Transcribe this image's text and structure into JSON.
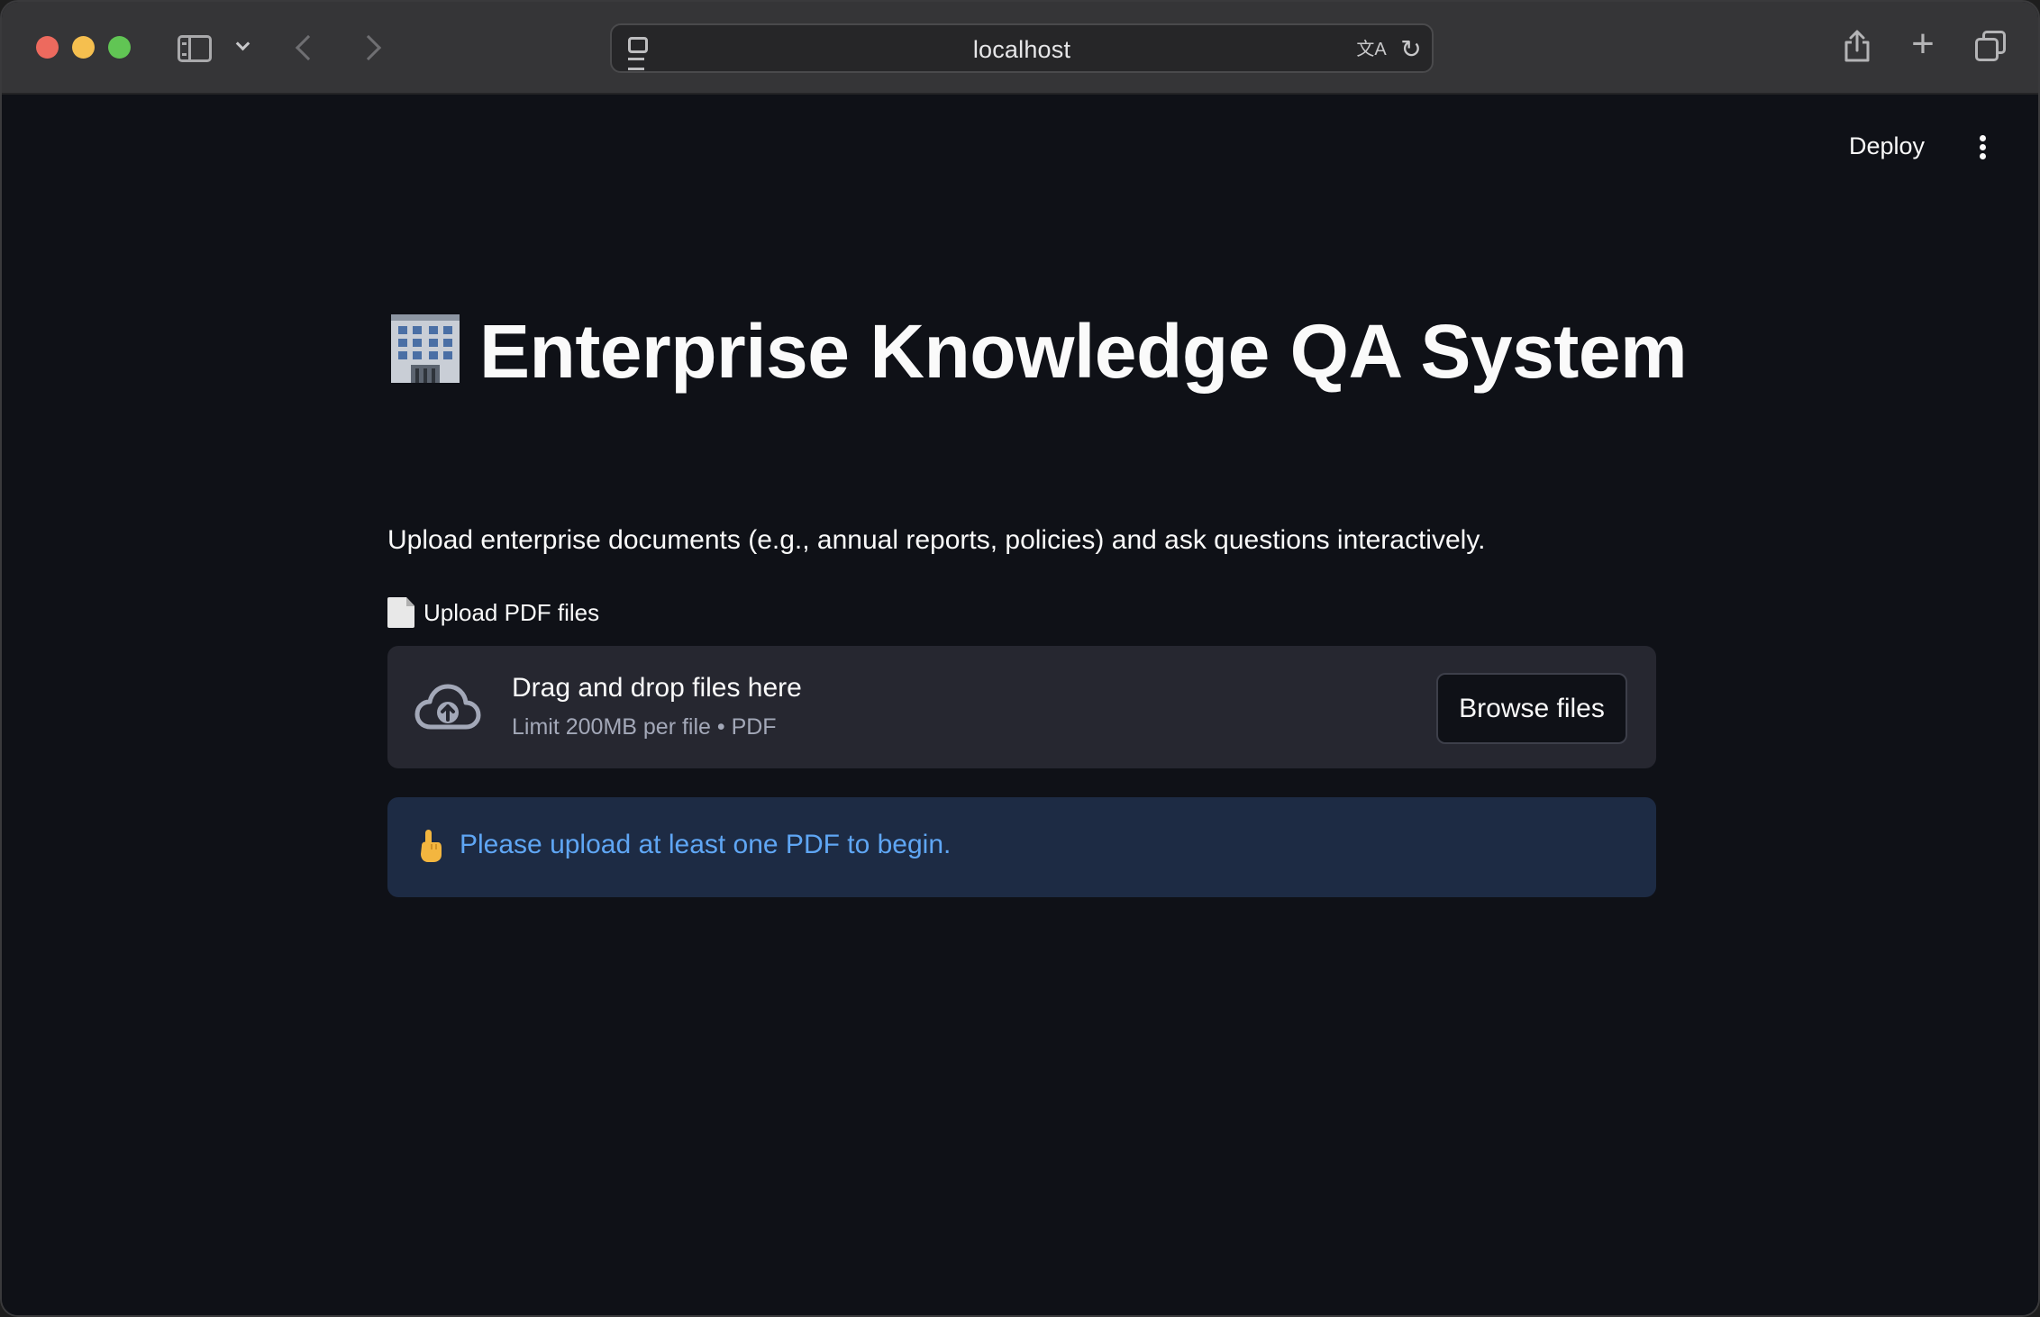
{
  "browser": {
    "url": "localhost",
    "translate_glyph": "文A",
    "reload_glyph": "↻",
    "plus_glyph": "+"
  },
  "app": {
    "deploy_label": "Deploy",
    "title_emoji": "office-building",
    "title": "Enterprise Knowledge QA System",
    "subtitle": "Upload enterprise documents (e.g., annual reports, policies) and ask questions interactively.",
    "uploader": {
      "label": "Upload PDF files",
      "drop_title": "Drag and drop files here",
      "drop_hint": "Limit 200MB per file • PDF",
      "browse_label": "Browse files"
    },
    "info": {
      "emoji": "pointing-hand",
      "message": "Please upload at least one PDF to begin."
    }
  },
  "colors": {
    "background": "#0f1117",
    "dropzone": "#262730",
    "info_bg": "#1d2b44",
    "info_text": "#5fa6f4"
  }
}
